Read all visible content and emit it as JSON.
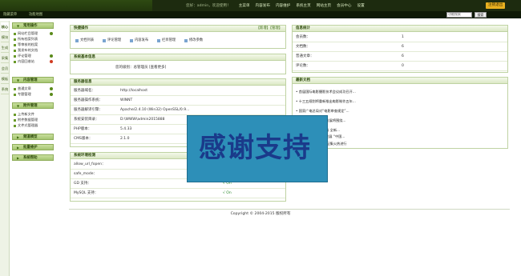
{
  "header": {
    "user_info": "您好：admin，欢迎使用！",
    "nav": [
      "主菜单",
      "内容发布",
      "内容维护",
      "系统主页",
      "网站主页",
      "会员中心",
      "设置"
    ],
    "logout": "注销退出",
    "sub_left_1": "隐藏菜单",
    "sub_left_2": "功能地图",
    "search_placeholder": "功能搜索",
    "search_button": "搜索"
  },
  "left_tabs": [
    "核心",
    "模块",
    "生成",
    "采集",
    "会员",
    "模板",
    "系统"
  ],
  "sidebar": {
    "sections": [
      {
        "title": "常用操作",
        "items": [
          "网站栏目管理",
          "所有档案列表",
          "等审核的档案",
          "我发布的文档",
          "评论管理",
          "内容回收站"
        ]
      },
      {
        "title": "内容管理",
        "items": [
          "普通文章",
          "专题管理"
        ]
      },
      {
        "title": "附件管理",
        "items": [
          "上传新文件",
          "附件数据管理",
          "文件式管理器"
        ]
      },
      {
        "title": "频道模型"
      },
      {
        "title": "批量维护"
      },
      {
        "title": "系统帮助"
      }
    ]
  },
  "quick": {
    "title": "快捷操作",
    "tail": "【新增】【管理】",
    "buttons": [
      "文档列表",
      "评论管理",
      "内容发布",
      "栏目管理",
      "修改参数"
    ]
  },
  "sysinfo_basic": {
    "title": "系统基本信息",
    "text": "您的级别：总管理员 [查看更多]"
  },
  "server": {
    "title": "服务器信息",
    "rows": [
      {
        "k": "服务器域名：",
        "v": "http://localhost"
      },
      {
        "k": "服务器操作系统：",
        "v": "WINNT"
      },
      {
        "k": "服务器解译引擎：",
        "v": "Apache/2.4.10 (Win32) OpenSSL/0.9..."
      },
      {
        "k": "系统安装目录：",
        "v": "D:\\WWW\\admin2015888"
      },
      {
        "k": "PHP版本：",
        "v": "5.4.33"
      },
      {
        "k": "CMS版本：",
        "v": "2.1.0"
      }
    ]
  },
  "env": {
    "title": "系统环境检测",
    "rows": [
      {
        "k": "allow_url_fopen：",
        "ok": ""
      },
      {
        "k": "safe_mode：",
        "ok": ""
      },
      {
        "k": "GD 支持：",
        "ok": "√ On"
      },
      {
        "k": "MySQL 支持：",
        "ok": "√ On"
      }
    ]
  },
  "stats": {
    "title": "信息统计",
    "rows": [
      {
        "k": "会员数：",
        "v": "1"
      },
      {
        "k": "文档数：",
        "v": "6"
      },
      {
        "k": "普通文章：",
        "v": "6"
      },
      {
        "k": "评论数：",
        "v": "0"
      }
    ]
  },
  "news": {
    "title": "最新文档",
    "items": [
      "• 首届国际电影摄影技术会议成功召开...",
      "• 十三五规划将重新推出电影制作五年...",
      "• 国家广电总局对“电影审查规定”...",
      "• “十三五”中国电影发展将围绕...",
      "• ...期间文化消费升级 全新...",
      "• ...影视产业迎来新发展 “中国...",
      "• ...和创意策划 作品征集火热进行"
    ]
  },
  "overlay_text": "感谢支持",
  "footer": "Copyright © 2004-2015 版权所有"
}
